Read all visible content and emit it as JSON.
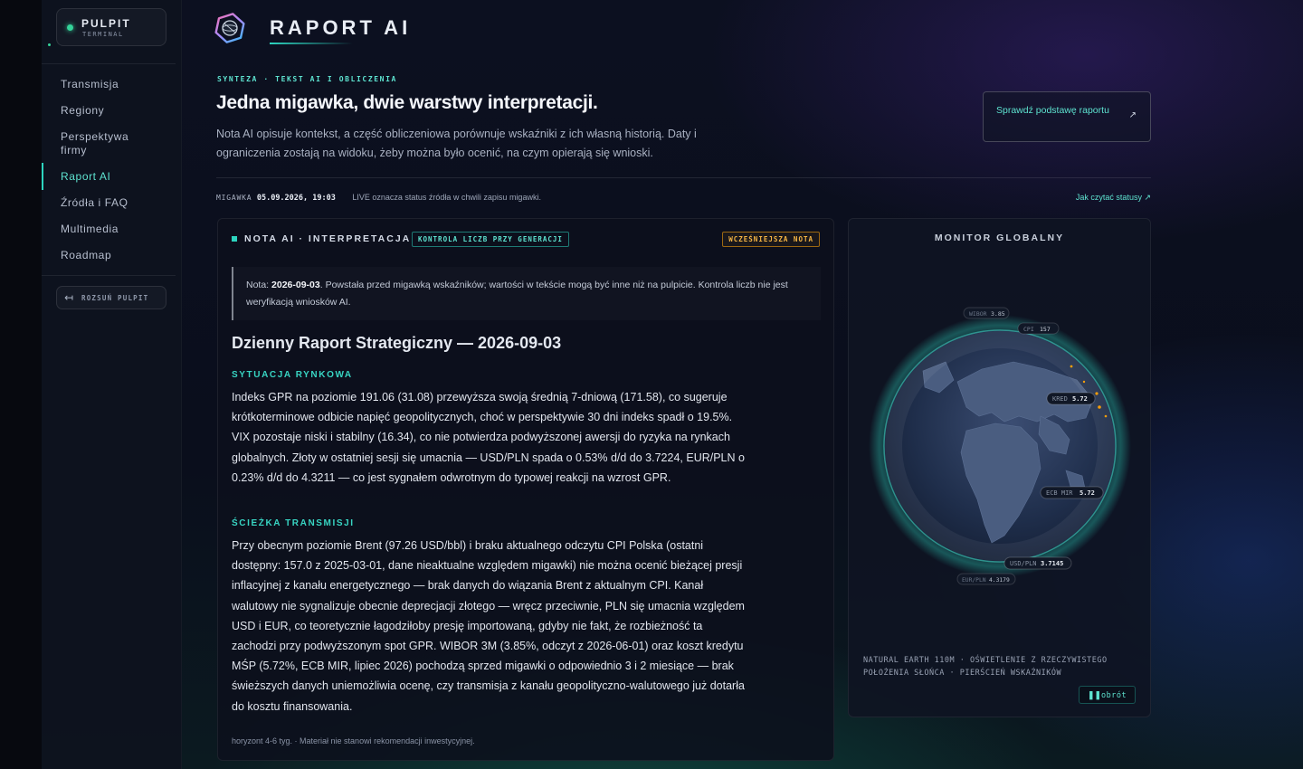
{
  "sidebar": {
    "brand_title": "PULPIT",
    "brand_sub": "TERMINAL",
    "items": [
      {
        "label": "Transmisja"
      },
      {
        "label": "Regiony"
      },
      {
        "label": "Perspektywa firmy"
      },
      {
        "label": "Raport AI",
        "active": true
      },
      {
        "label": "Źródła i FAQ"
      },
      {
        "label": "Multimedia"
      },
      {
        "label": "Roadmap"
      }
    ],
    "collapse_label": "ROZSUŃ PULPIT"
  },
  "header": {
    "title": "RAPORT AI"
  },
  "hero": {
    "eyebrow": "SYNTEZA · TEKST AI I OBLICZENIA",
    "title": "Jedna migawka, dwie warstwy interpretacji.",
    "desc": "Nota AI opisuje kontekst, a część obliczeniowa porównuje wskaźniki z ich własną historią. Daty i ograniczenia zostają na widoku, żeby można było ocenić, na czym opierają się wnioski.",
    "verify_label": "Sprawdź podstawę raportu",
    "verify_icon": "↗"
  },
  "snapshot": {
    "label": "MIGAWKA",
    "value": "05.09.2026, 19:03",
    "note": "LIVE oznacza status źródła w chwili zapisu migawki.",
    "howto": "Jak czytać statusy ↗"
  },
  "note": {
    "label": "NOTA AI · INTERPRETACJA",
    "badge_check": "KONTROLA LICZB PRZY GENERACJI",
    "badge_earlier": "WCZEŚNIEJSZA NOTA",
    "callout_prefix": "Nota: ",
    "callout_date": "2026-09-03",
    "callout_text": ". Powstała przed migawką wskaźników; wartości w tekście mogą być inne niż na pulpicie. Kontrola liczb nie jest weryfikacją wniosków AI.",
    "report_title": "Dzienny Raport Strategiczny — 2026-09-03",
    "sections": [
      {
        "heading": "SYTUACJA RYNKOWA",
        "text": "Indeks GPR na poziomie 191.06 (31.08) przewyższa swoją średnią 7-dniową (171.58), co sugeruje krótkoterminowe odbicie napięć geopolitycznych, choć w perspektywie 30 dni indeks spadł o 19.5%. VIX pozostaje niski i stabilny (16.34), co nie potwierdza podwyższonej awersji do ryzyka na rynkach globalnych. Złoty w ostatniej sesji się umacnia — USD/PLN spada o 0.53% d/d do 3.7224, EUR/PLN o 0.23% d/d do 4.3211 — co jest sygnałem odwrotnym do typowej reakcji na wzrost GPR."
      },
      {
        "heading": "ŚCIEŻKA TRANSMISJI",
        "text": "Przy obecnym poziomie Brent (97.26 USD/bbl) i braku aktualnego odczytu CPI Polska (ostatni dostępny: 157.0 z 2025-03-01, dane nieaktualne względem migawki) nie można ocenić bieżącej presji inflacyjnej z kanału energetycznego — brak danych do wiązania Brent z aktualnym CPI. Kanał walutowy nie sygnalizuje obecnie deprecjacji złotego — wręcz przeciwnie, PLN się umacnia względem USD i EUR, co teoretycznie łagodziłoby presję importowaną, gdyby nie fakt, że rozbieżność ta zachodzi przy podwyższonym spot GPR. WIBOR 3M (3.85%, odczyt z 2026-06-01) oraz koszt kredytu MŚP (5.72%, ECB MIR, lipiec 2026) pochodzą sprzed migawki o odpowiednio 3 i 2 miesiące — brak świeższych danych uniemożliwia ocenę, czy transmisja z kanału geopolityczno-walutowego już dotarła do kosztu finansowania."
      }
    ],
    "footnote": "horyzont 4-6 tyg. · Materiał nie stanowi rekomendacji inwestycyjnej."
  },
  "globe": {
    "title": "MONITOR GLOBALNY",
    "tags": [
      {
        "k": "WIBOR",
        "v": "3.85"
      },
      {
        "k": "CPI",
        "v": "157"
      },
      {
        "k": "KRED",
        "v": "5.72"
      },
      {
        "k": "ECB MIR",
        "v": "5.72"
      },
      {
        "k": "USD/PLN",
        "v": "3.7145"
      },
      {
        "k": "EUR/PLN",
        "v": "4.3179"
      }
    ],
    "caption": "NATURAL EARTH 110M · OŚWIETLENIE Z RZECZYWISTEGO POŁOŻENIA SŁOŃCA · PIERŚCIEŃ WSKAŹNIKÓW",
    "rotate_icon": "❚❚",
    "rotate_label": "obrót"
  }
}
